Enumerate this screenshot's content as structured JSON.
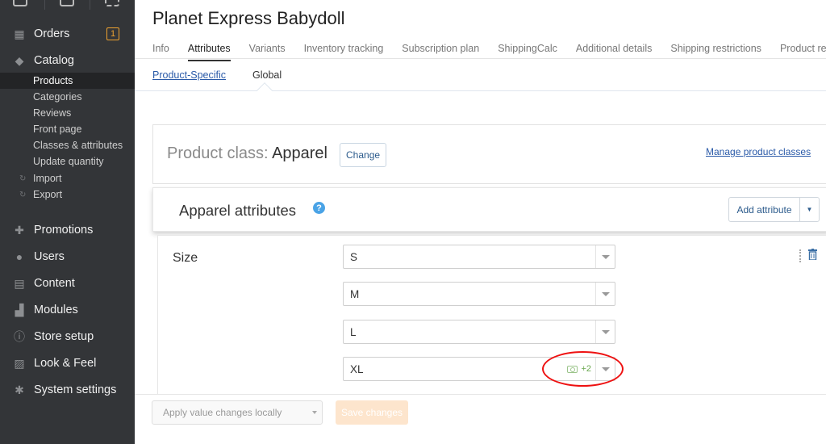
{
  "sidebar": {
    "orders": {
      "label": "Orders",
      "badge": "1"
    },
    "catalog": {
      "label": "Catalog"
    },
    "catalog_items": [
      {
        "label": "Products"
      },
      {
        "label": "Categories"
      },
      {
        "label": "Reviews"
      },
      {
        "label": "Front page"
      },
      {
        "label": "Classes & attributes"
      },
      {
        "label": "Update quantity"
      },
      {
        "label": "Import"
      },
      {
        "label": "Export"
      }
    ],
    "sections": [
      {
        "label": "Promotions",
        "icon": "gift-icon"
      },
      {
        "label": "Users",
        "icon": "users-icon"
      },
      {
        "label": "Content",
        "icon": "content-icon"
      },
      {
        "label": "Modules",
        "icon": "puzzle-icon"
      },
      {
        "label": "Store setup",
        "icon": "info-icon"
      },
      {
        "label": "Look & Feel",
        "icon": "image-icon"
      },
      {
        "label": "System settings",
        "icon": "gear-icon"
      }
    ]
  },
  "page": {
    "title": "Planet Express Babydoll"
  },
  "tabs": [
    {
      "label": "Info"
    },
    {
      "label": "Attributes"
    },
    {
      "label": "Variants"
    },
    {
      "label": "Inventory tracking"
    },
    {
      "label": "Subscription plan"
    },
    {
      "label": "ShippingCalc"
    },
    {
      "label": "Additional details"
    },
    {
      "label": "Shipping restrictions"
    },
    {
      "label": "Product re"
    }
  ],
  "subtabs": [
    {
      "label": "Product-Specific"
    },
    {
      "label": "Global"
    }
  ],
  "product_class": {
    "label": "Product class:",
    "value": "Apparel",
    "change_label": "Change",
    "manage_link": "Manage product classes"
  },
  "attributes": {
    "title": "Apparel attributes",
    "add_label": "Add attribute",
    "attribute_name": "Size",
    "values": [
      "S",
      "M",
      "L",
      "XL"
    ],
    "extra_count": "+2"
  },
  "footer": {
    "apply_label": "Apply value changes locally",
    "save_label": "Save changes"
  },
  "colors": {
    "sidebar_bg": "#333538",
    "link": "#2a5aa8",
    "badge": "#f0a330",
    "highlight": "#e11111"
  }
}
